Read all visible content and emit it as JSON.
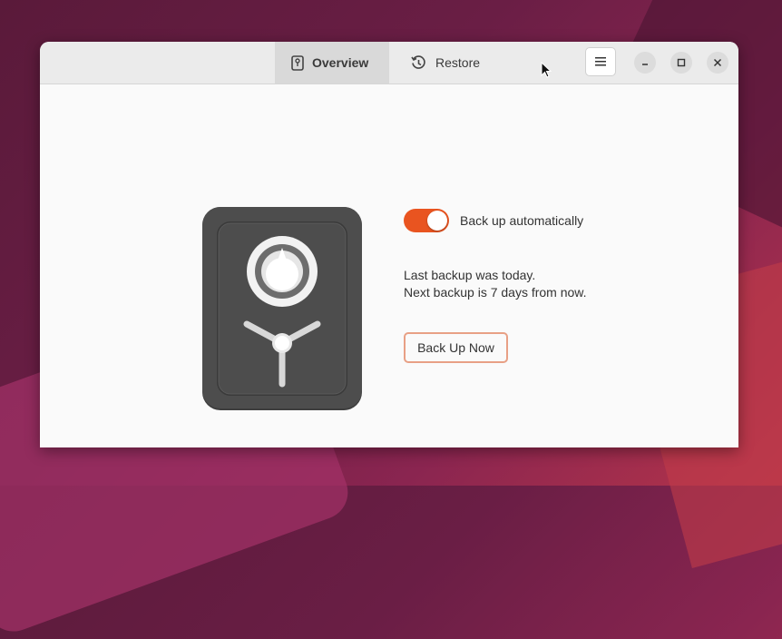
{
  "header": {
    "tabs": [
      {
        "label": "Overview",
        "icon": "vault-icon",
        "active": true
      },
      {
        "label": "Restore",
        "icon": "history-icon",
        "active": false
      }
    ],
    "menu_icon": "hamburger-menu-icon",
    "window_controls": [
      "minimize-icon",
      "maximize-icon",
      "close-icon"
    ]
  },
  "main": {
    "auto_backup_label": "Back up automatically",
    "auto_backup_enabled": true,
    "status_line1": "Last backup was today.",
    "status_line2": "Next backup is 7 days from now.",
    "backup_now_label": "Back Up Now"
  },
  "colors": {
    "accent": "#e95420",
    "button_border": "#e8a085",
    "vault_body": "#4a4a4a"
  }
}
